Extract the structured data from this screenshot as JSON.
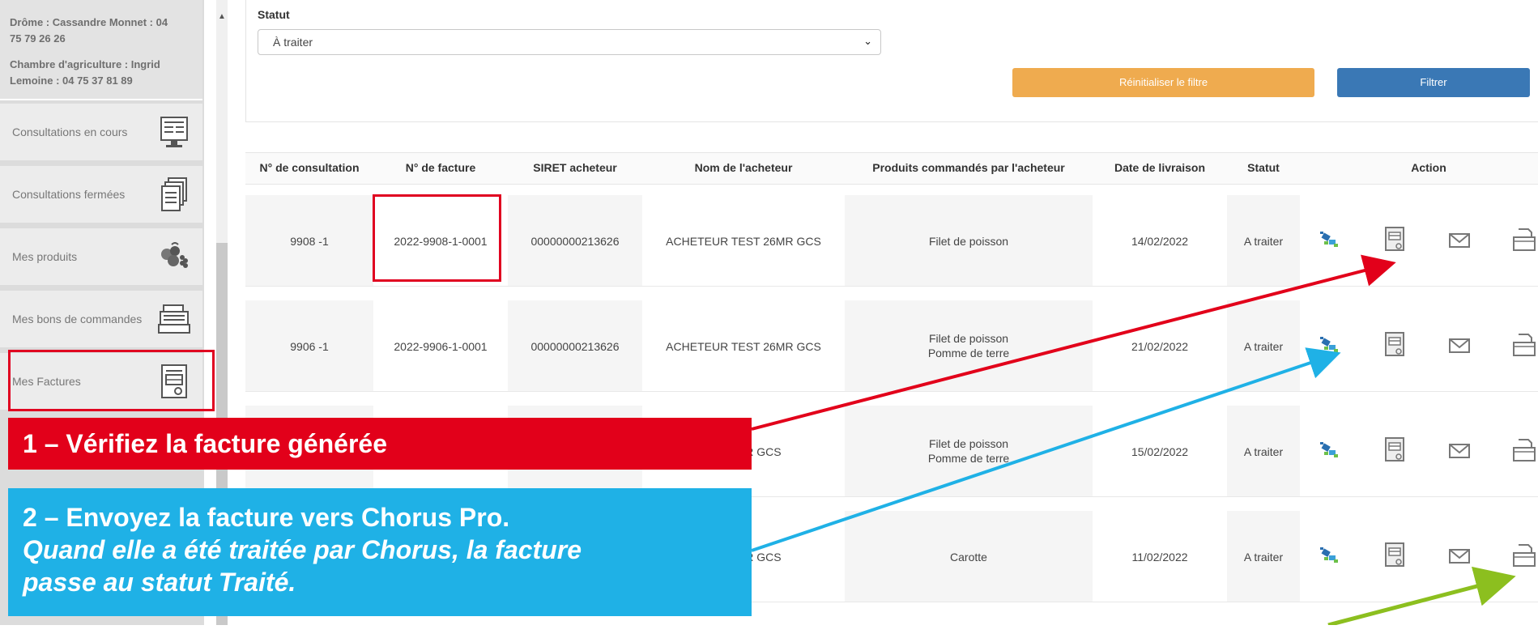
{
  "sidebar": {
    "contact_lines": [
      "Drôme : Cassandre Monnet : 04 75 79 26 26",
      "Chambre d'agriculture : Ingrid Lemoine : 04 75 37 81 89"
    ],
    "items": [
      {
        "label": "Consultations en cours",
        "icon": "consultation-sheet-icon"
      },
      {
        "label": "Consultations fermées",
        "icon": "stacked-documents-icon"
      },
      {
        "label": "Mes produits",
        "icon": "fruit-basket-icon"
      },
      {
        "label": "Mes bons de commandes",
        "icon": "cash-register-icon"
      },
      {
        "label": "Mes Factures",
        "icon": "invoice-icon"
      }
    ]
  },
  "filter": {
    "statut_label": "Statut",
    "statut_value": "À traiter",
    "reset_label": "Réinitialiser le filtre",
    "filter_label": "Filtrer"
  },
  "table": {
    "headers": [
      "N° de consultation",
      "N° de facture",
      "SIRET acheteur",
      "Nom de l'acheteur",
      "Produits commandés par l'acheteur",
      "Date de livraison",
      "Statut",
      "Action"
    ],
    "rows": [
      {
        "consultation": "9908 -1",
        "facture": "2022-9908-1-0001",
        "siret": "00000000213626",
        "acheteur": "ACHETEUR TEST 26MR GCS",
        "produits": [
          "Filet de poisson"
        ],
        "date": "14/02/2022",
        "statut": "A traiter"
      },
      {
        "consultation": "9906 -1",
        "facture": "2022-9906-1-0001",
        "siret": "00000000213626",
        "acheteur": "ACHETEUR TEST 26MR GCS",
        "produits": [
          "Filet de poisson",
          "Pomme de terre"
        ],
        "date": "21/02/2022",
        "statut": "A traiter"
      },
      {
        "acheteur": "ST 26MR GCS",
        "produits": [
          "Filet de poisson",
          "Pomme de terre"
        ],
        "date": "15/02/2022",
        "statut": "A traiter"
      },
      {
        "acheteur": "ST 26MR GCS",
        "produits": [
          "Carotte"
        ],
        "date": "11/02/2022",
        "statut": "A traiter"
      }
    ],
    "action_icons": [
      "chorus-send-icon",
      "view-invoice-icon",
      "mail-icon",
      "download-document-icon"
    ]
  },
  "annotations": {
    "step1": "1 – Vérifiez la facture générée",
    "step2_title": "2 – Envoyez la facture vers Chorus Pro.",
    "step2_note_line1": "Quand elle a été traitée par Chorus, la facture",
    "step2_note_line2": "passe au statut Traité.",
    "colors": {
      "red": "#e2001a",
      "blue": "#1fb1e6",
      "green": "#8cbf1f"
    }
  }
}
